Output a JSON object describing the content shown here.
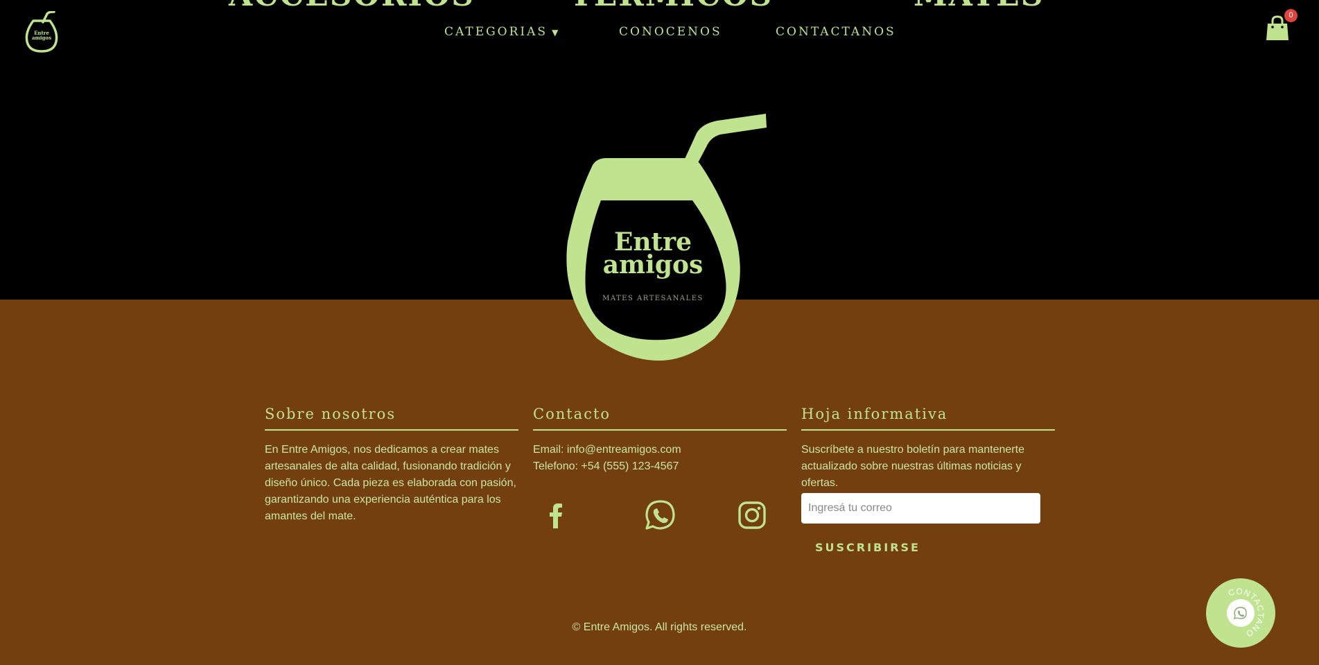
{
  "colors": {
    "accent": "#bfe38f",
    "footer_bg": "#733f0f",
    "header_bg": "#000000",
    "badge": "#e0443f"
  },
  "header": {
    "logo_text_line1": "Entre",
    "logo_text_line2": "amigos",
    "cut_headings": [
      "ACCESORIOS",
      "TERMICOS",
      "MATES"
    ],
    "nav": {
      "categorias": "CATEGORIAS",
      "caret": "▼",
      "conocenos": "CONOCENOS",
      "contactanos": "CONTACTANOS"
    },
    "cart": {
      "icon": "shopping-bag-icon",
      "count": "0"
    }
  },
  "hero_logo": {
    "line1": "Entre",
    "line2": "amigos",
    "tagline": "MATES ARTESANALES"
  },
  "footer": {
    "about": {
      "title": "Sobre nosotros",
      "text": "En Entre Amigos, nos dedicamos a crear mates artesanales de alta calidad, fusionando tradición y diseño único. Cada pieza es elaborada con pasión, garantizando una experiencia auténtica para los amantes del mate."
    },
    "contact": {
      "title": "Contacto",
      "email": "Email: info@entreamigos.com",
      "phone": "Telefono: +54 (555) 123-4567",
      "social_icons": [
        "facebook-icon",
        "whatsapp-icon",
        "instagram-icon"
      ]
    },
    "newsletter": {
      "title": "Hoja informativa",
      "text": "Suscríbete a nuestro boletín para mantenerte actualizado sobre nuestras últimas noticias y ofertas.",
      "placeholder": "Ingresá tu correo",
      "button": "SUSCRIBIRSE"
    },
    "copyright": "© Entre Amigos. All rights reserved."
  },
  "floating_button": {
    "label": "CONTACTANOS",
    "icon": "whatsapp-icon"
  }
}
